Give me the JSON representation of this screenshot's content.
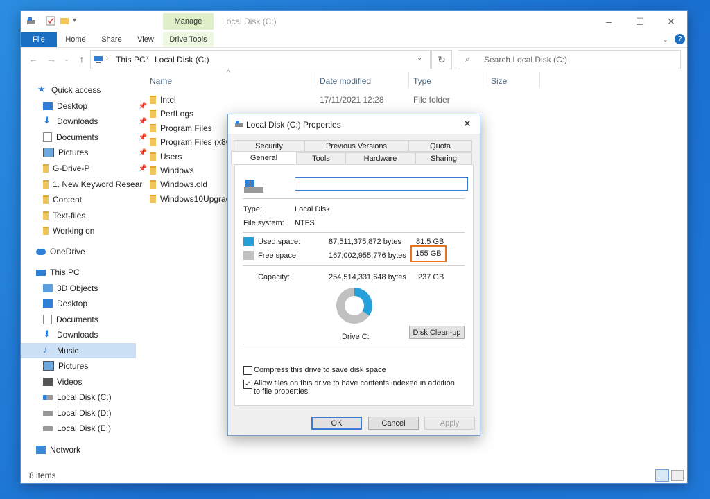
{
  "window": {
    "title": "Local Disk (C:)",
    "manage_tab": "Manage",
    "ribbon_tabs": [
      "File",
      "Home",
      "Share",
      "View",
      "Drive Tools"
    ],
    "breadcrumb": [
      "This PC",
      "Local Disk (C:)"
    ],
    "search_placeholder": "Search Local Disk (C:)",
    "status": "8 items"
  },
  "columns": [
    "Name",
    "Date modified",
    "Type",
    "Size"
  ],
  "files": [
    {
      "name": "Intel",
      "date": "17/11/2021 12:28",
      "type": "File folder"
    },
    {
      "name": "PerfLogs",
      "date": "",
      "type": ""
    },
    {
      "name": "Program Files",
      "date": "",
      "type": ""
    },
    {
      "name": "Program Files (x86",
      "date": "",
      "type": ""
    },
    {
      "name": "Users",
      "date": "",
      "type": ""
    },
    {
      "name": "Windows",
      "date": "",
      "type": ""
    },
    {
      "name": "Windows.old",
      "date": "",
      "type": ""
    },
    {
      "name": "Windows10Upgrad",
      "date": "",
      "type": ""
    }
  ],
  "sidebar": {
    "quick_access": "Quick access",
    "quick_items": [
      "Desktop",
      "Downloads",
      "Documents",
      "Pictures",
      "G-Drive-P",
      "1. New Keyword Resear",
      "Content",
      "Text-files",
      "Working on"
    ],
    "onedrive": "OneDrive",
    "this_pc": "This PC",
    "pc_items": [
      "3D Objects",
      "Desktop",
      "Documents",
      "Downloads",
      "Music",
      "Pictures",
      "Videos",
      "Local Disk (C:)",
      "Local Disk (D:)",
      "Local Disk (E:)"
    ],
    "network": "Network"
  },
  "dialog": {
    "title": "Local Disk (C:) Properties",
    "tabs_top": [
      "Security",
      "Previous Versions",
      "Quota"
    ],
    "tabs_bottom": [
      "General",
      "Tools",
      "Hardware",
      "Sharing"
    ],
    "name_value": "",
    "type_label": "Type:",
    "type_value": "Local Disk",
    "fs_label": "File system:",
    "fs_value": "NTFS",
    "used_label": "Used space:",
    "used_bytes": "87,511,375,872 bytes",
    "used_gb": "81.5 GB",
    "free_label": "Free space:",
    "free_bytes": "167,002,955,776 bytes",
    "free_gb": "155 GB",
    "cap_label": "Capacity:",
    "cap_bytes": "254,514,331,648 bytes",
    "cap_gb": "237 GB",
    "drive_label": "Drive C:",
    "cleanup": "Disk Clean-up",
    "compress": "Compress this drive to save disk space",
    "index": "Allow files on this drive to have contents indexed in addition to file properties",
    "ok": "OK",
    "cancel": "Cancel",
    "apply": "Apply"
  },
  "colors": {
    "used": "#26a0da",
    "free": "#c0c0c0",
    "highlight": "#e8731f",
    "accent": "#1a6fc2"
  },
  "chart_data": {
    "type": "pie",
    "categories": [
      "Used space",
      "Free space"
    ],
    "values": [
      81.5,
      155
    ]
  }
}
